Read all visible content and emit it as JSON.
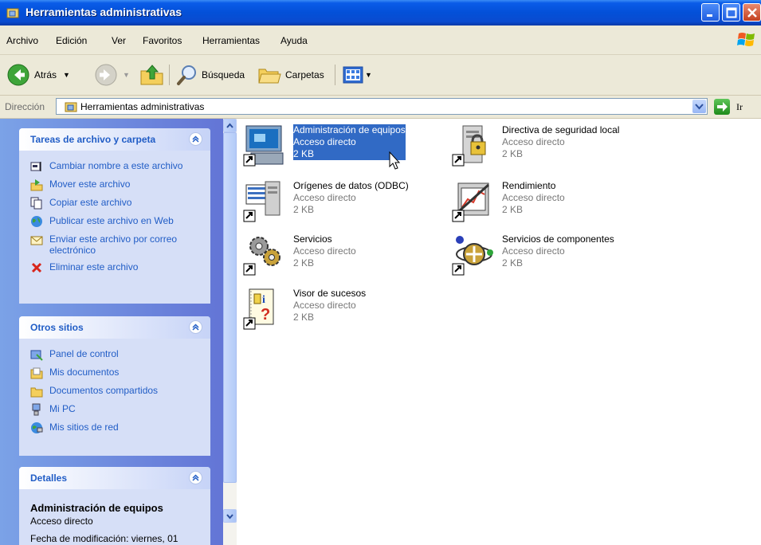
{
  "window": {
    "title": "Herramientas administrativas"
  },
  "menu": {
    "items": [
      "Archivo",
      "Edición",
      "Ver",
      "Favoritos",
      "Herramientas",
      "Ayuda"
    ]
  },
  "toolbar": {
    "back_label": "Atrás",
    "search_label": "Búsqueda",
    "folders_label": "Carpetas"
  },
  "address": {
    "label": "Dirección",
    "value": "Herramientas administrativas",
    "go_label": "Ir"
  },
  "tasks_panel": {
    "title": "Tareas de archivo y carpeta",
    "items": [
      {
        "label": "Cambiar nombre a este archivo",
        "icon": "rename-icon"
      },
      {
        "label": "Mover este archivo",
        "icon": "move-icon"
      },
      {
        "label": "Copiar este archivo",
        "icon": "copy-icon"
      },
      {
        "label": "Publicar este archivo en Web",
        "icon": "publish-web-icon"
      },
      {
        "label": "Enviar este archivo por correo electrónico",
        "icon": "email-icon"
      },
      {
        "label": "Eliminar este archivo",
        "icon": "delete-icon"
      }
    ]
  },
  "places_panel": {
    "title": "Otros sitios",
    "items": [
      {
        "label": "Panel de control",
        "icon": "control-panel-icon"
      },
      {
        "label": "Mis documentos",
        "icon": "my-documents-icon"
      },
      {
        "label": "Documentos compartidos",
        "icon": "shared-folder-icon"
      },
      {
        "label": "Mi PC",
        "icon": "my-computer-icon"
      },
      {
        "label": "Mis sitios de red",
        "icon": "network-places-icon"
      }
    ]
  },
  "details_panel": {
    "title": "Detalles",
    "file_name": "Administración de equipos",
    "file_type": "Acceso directo",
    "modified": "Fecha de modificación: viernes, 01"
  },
  "files": [
    {
      "name": "Administración de equipos",
      "type": "Acceso directo",
      "size": "2 KB",
      "selected": true,
      "icon": "computer-management-icon"
    },
    {
      "name": "Directiva de seguridad local",
      "type": "Acceso directo",
      "size": "2 KB",
      "selected": false,
      "icon": "local-security-policy-icon"
    },
    {
      "name": "Orígenes de datos (ODBC)",
      "type": "Acceso directo",
      "size": "2 KB",
      "selected": false,
      "icon": "odbc-icon"
    },
    {
      "name": "Rendimiento",
      "type": "Acceso directo",
      "size": "2 KB",
      "selected": false,
      "icon": "performance-icon"
    },
    {
      "name": "Servicios",
      "type": "Acceso directo",
      "size": "2 KB",
      "selected": false,
      "icon": "services-icon"
    },
    {
      "name": "Servicios de componentes",
      "type": "Acceso directo",
      "size": "2 KB",
      "selected": false,
      "icon": "component-services-icon"
    },
    {
      "name": "Visor de sucesos",
      "type": "Acceso directo",
      "size": "2 KB",
      "selected": false,
      "icon": "event-viewer-icon"
    }
  ],
  "colors": {
    "titlebar": "#0a5ce8",
    "selection": "#316ac5",
    "link": "#215dc6",
    "panel_bg": "#d6dff7"
  }
}
